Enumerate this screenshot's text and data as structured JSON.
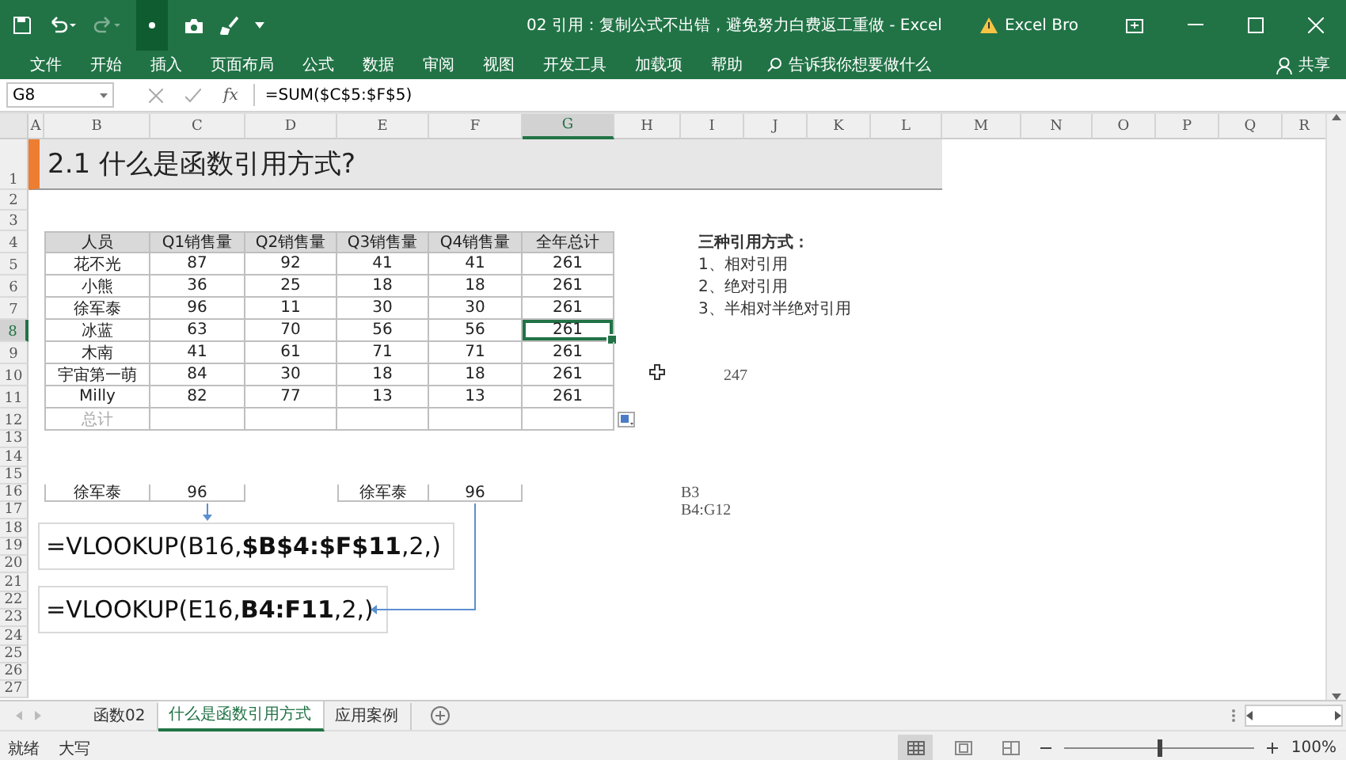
{
  "title_bar": {
    "title": "02 引用：复制公式不出错，避免努力白费返工重做  -  Excel",
    "account": "Excel Bro"
  },
  "ribbon": {
    "tabs": [
      "文件",
      "开始",
      "插入",
      "页面布局",
      "公式",
      "数据",
      "审阅",
      "视图",
      "开发工具",
      "加载项",
      "帮助"
    ],
    "tell_me": "告诉我你想要做什么",
    "share": "共享"
  },
  "formula_bar": {
    "name_box": "G8",
    "insert_function": "fx",
    "formula": "=SUM($C$5:$F$5)"
  },
  "columns": [
    {
      "label": "A",
      "selected": false
    },
    {
      "label": "B",
      "selected": false
    },
    {
      "label": "C",
      "selected": false
    },
    {
      "label": "D",
      "selected": false
    },
    {
      "label": "E",
      "selected": false
    },
    {
      "label": "F",
      "selected": false
    },
    {
      "label": "G",
      "selected": true
    },
    {
      "label": "H",
      "selected": false
    },
    {
      "label": "I",
      "selected": false
    },
    {
      "label": "J",
      "selected": false
    },
    {
      "label": "K",
      "selected": false
    },
    {
      "label": "L",
      "selected": false
    },
    {
      "label": "M",
      "selected": false
    },
    {
      "label": "N",
      "selected": false
    },
    {
      "label": "O",
      "selected": false
    },
    {
      "label": "P",
      "selected": false
    },
    {
      "label": "Q",
      "selected": false
    },
    {
      "label": "R",
      "selected": false
    }
  ],
  "rows": [
    {
      "label": "1",
      "selected": false
    },
    {
      "label": "2",
      "selected": false
    },
    {
      "label": "3",
      "selected": false
    },
    {
      "label": "4",
      "selected": false
    },
    {
      "label": "5",
      "selected": false
    },
    {
      "label": "6",
      "selected": false
    },
    {
      "label": "7",
      "selected": false
    },
    {
      "label": "8",
      "selected": true
    },
    {
      "label": "9",
      "selected": false
    },
    {
      "label": "10",
      "selected": false
    },
    {
      "label": "11",
      "selected": false
    },
    {
      "label": "12",
      "selected": false
    },
    {
      "label": "13",
      "selected": false
    },
    {
      "label": "14",
      "selected": false
    },
    {
      "label": "15",
      "selected": false
    },
    {
      "label": "16",
      "selected": false
    },
    {
      "label": "17",
      "selected": false
    },
    {
      "label": "18",
      "selected": false
    },
    {
      "label": "19",
      "selected": false
    },
    {
      "label": "20",
      "selected": false
    },
    {
      "label": "21",
      "selected": false
    },
    {
      "label": "22",
      "selected": false
    },
    {
      "label": "23",
      "selected": false
    },
    {
      "label": "24",
      "selected": false
    },
    {
      "label": "25",
      "selected": false
    },
    {
      "label": "26",
      "selected": false
    },
    {
      "label": "27",
      "selected": false
    }
  ],
  "sheet": {
    "heading": "2.1  什么是函数引用方式?",
    "table": {
      "columns": [
        "人员",
        "Q1销售量",
        "Q2销售量",
        "Q3销售量",
        "Q4销售量",
        "全年总计"
      ],
      "rows": [
        {
          "name": "花不光",
          "quarters": [
            "87",
            "92",
            "41",
            "41"
          ],
          "total": {
            "text": "261",
            "selected": false
          }
        },
        {
          "name": "小熊",
          "quarters": [
            "36",
            "25",
            "18",
            "18"
          ],
          "total": {
            "text": "261",
            "selected": false
          }
        },
        {
          "name": "徐军泰",
          "quarters": [
            "96",
            "11",
            "30",
            "30"
          ],
          "total": {
            "text": "261",
            "selected": false
          }
        },
        {
          "name": "冰蓝",
          "quarters": [
            "63",
            "70",
            "56",
            "56"
          ],
          "total": {
            "text": "261",
            "selected": true
          }
        },
        {
          "name": "木南",
          "quarters": [
            "41",
            "61",
            "71",
            "71"
          ],
          "total": {
            "text": "261",
            "selected": false
          }
        },
        {
          "name": "宇宙第一萌",
          "quarters": [
            "84",
            "30",
            "18",
            "18"
          ],
          "total": {
            "text": "261",
            "selected": false
          }
        },
        {
          "name": "Milly",
          "quarters": [
            "82",
            "77",
            "13",
            "13"
          ],
          "total": {
            "text": "261",
            "selected": false
          }
        }
      ],
      "total_label": "总计"
    },
    "notes": {
      "heading": "三种引用方式：",
      "items": [
        "1、相对引用",
        "2、绝对引用",
        "3、半相对半绝对引用"
      ]
    },
    "value_cell": "247",
    "range_notes": [
      "B3",
      "B4:G12"
    ],
    "lookups": [
      {
        "name": "徐军泰",
        "value": "96",
        "formula": "=VLOOKUP(B16,**$B$4:$F$11**,2,)"
      },
      {
        "name": "徐军泰",
        "value": "96",
        "formula": "=VLOOKUP(E16,**B4:F11**,2,)"
      }
    ]
  },
  "sheet_tabs": [
    {
      "label": "函数02",
      "selected": false
    },
    {
      "label": "什么是函数引用方式",
      "selected": true
    },
    {
      "label": "应用案例",
      "selected": false
    }
  ],
  "status_bar": {
    "ready": "就绪",
    "caps": "大写",
    "zoom": {
      "level": 0.5,
      "reading": "100%"
    }
  }
}
